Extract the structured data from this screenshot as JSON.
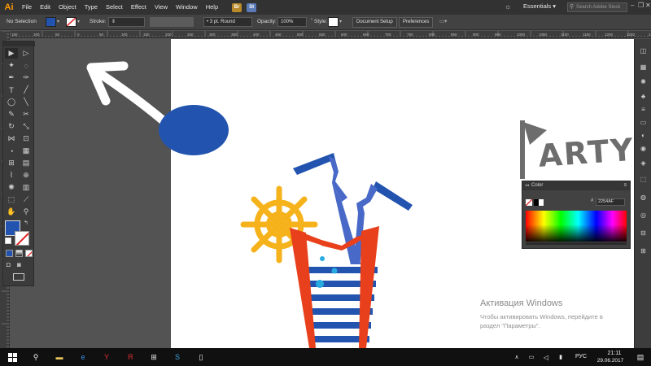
{
  "app": {
    "logo": "Ai"
  },
  "menu": [
    "File",
    "Edit",
    "Object",
    "Type",
    "Select",
    "Effect",
    "View",
    "Window",
    "Help"
  ],
  "bridge_buttons": [
    {
      "label": "Br",
      "color": "#b88a2a"
    },
    {
      "label": "St",
      "color": "#5a7bb5"
    }
  ],
  "workspace": {
    "label": "Essentials",
    "arrow": "▾"
  },
  "search": {
    "placeholder": "Search Adobe Stock"
  },
  "window_controls": [
    "–",
    "❐",
    "✕"
  ],
  "control_bar": {
    "selection_label": "No Selection",
    "fill_color": "#2254AF",
    "stroke_label": "Stroke:",
    "brush_label": "3 pt. Round",
    "opacity_label": "Opacity:",
    "opacity_value": "100%",
    "style_label": "Style:",
    "document_setup": "Document Setup",
    "preferences": "Preferences"
  },
  "ruler_ticks": [
    "150",
    "100",
    "50",
    "0",
    "50",
    "100",
    "150",
    "200",
    "250",
    "300",
    "350",
    "400",
    "450",
    "500",
    "550",
    "600",
    "650",
    "700",
    "750",
    "800",
    "850",
    "900",
    "950",
    "1000",
    "1050",
    "1100",
    "1150",
    "1200",
    "1250",
    "1300"
  ],
  "toolbar": {
    "tools": [
      {
        "name": "selection-tool",
        "glyph": "▶"
      },
      {
        "name": "direct-selection-tool",
        "glyph": "▷"
      },
      {
        "name": "magic-wand-tool",
        "glyph": "✦"
      },
      {
        "name": "lasso-tool",
        "glyph": "◌"
      },
      {
        "name": "pen-tool",
        "glyph": "✒"
      },
      {
        "name": "curvature-tool",
        "glyph": "✑"
      },
      {
        "name": "type-tool",
        "glyph": "T"
      },
      {
        "name": "line-tool",
        "glyph": "╱"
      },
      {
        "name": "ellipse-tool",
        "glyph": "◯"
      },
      {
        "name": "paintbrush-tool",
        "glyph": "╲"
      },
      {
        "name": "pencil-tool",
        "glyph": "✎"
      },
      {
        "name": "scissors-tool",
        "glyph": "✂"
      },
      {
        "name": "rotate-tool",
        "glyph": "↻"
      },
      {
        "name": "scale-tool",
        "glyph": "⤡"
      },
      {
        "name": "width-tool",
        "glyph": "⋈"
      },
      {
        "name": "free-transform-tool",
        "glyph": "⊡"
      },
      {
        "name": "shape-builder-tool",
        "glyph": "◔"
      },
      {
        "name": "perspective-grid-tool",
        "glyph": "▦"
      },
      {
        "name": "mesh-tool",
        "glyph": "⊞"
      },
      {
        "name": "gradient-tool",
        "glyph": "▤"
      },
      {
        "name": "eyedropper-tool",
        "glyph": "⌇"
      },
      {
        "name": "blend-tool",
        "glyph": "⊕"
      },
      {
        "name": "symbol-sprayer-tool",
        "glyph": "✺"
      },
      {
        "name": "column-graph-tool",
        "glyph": "▥"
      },
      {
        "name": "artboard-tool",
        "glyph": "⬚"
      },
      {
        "name": "slice-tool",
        "glyph": "⟋"
      },
      {
        "name": "hand-tool",
        "glyph": "✋"
      },
      {
        "name": "zoom-tool",
        "glyph": "⚲"
      }
    ],
    "fill_color": "#2254AF"
  },
  "color_panel": {
    "title": "Color",
    "hash": "#",
    "hex_value": "2254AF"
  },
  "artwork": {
    "party_letters": "ARTY"
  },
  "watermark": {
    "title": "Активация Windows",
    "line1": "Чтобы активировать Windows, перейдите в",
    "line2": "раздел \"Параметры\"."
  },
  "taskbar": {
    "language": "РУС",
    "time": "21:11",
    "date": "29.06.2017"
  }
}
